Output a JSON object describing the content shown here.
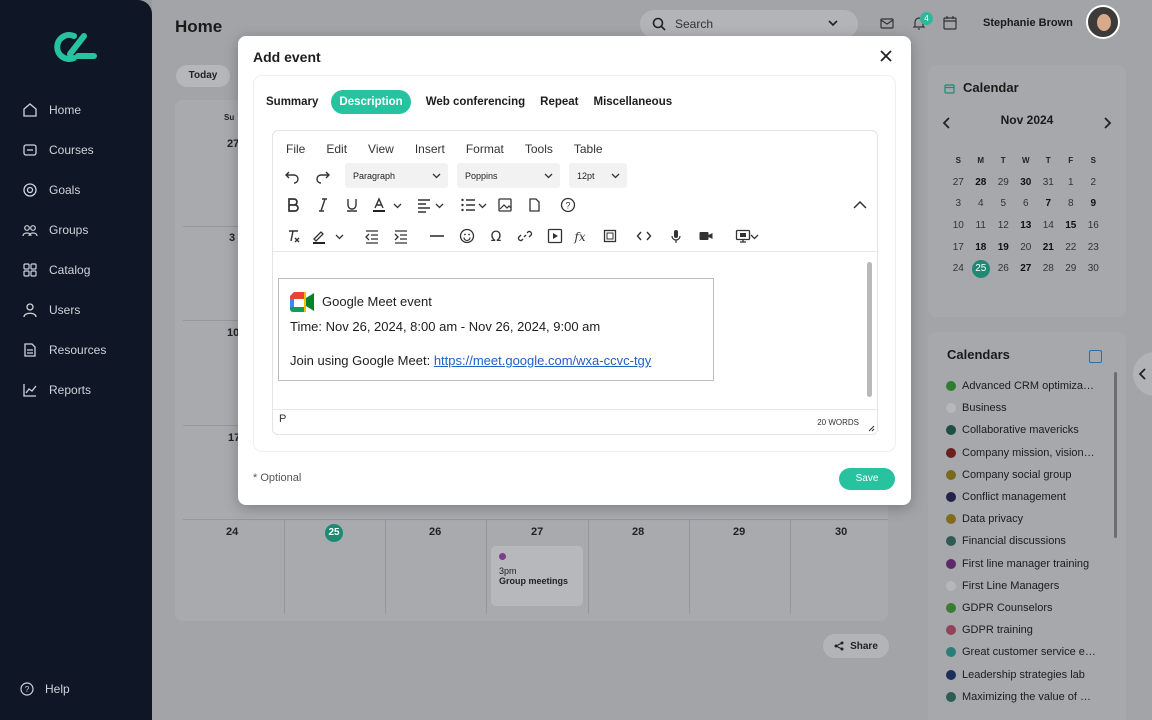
{
  "app": {
    "page_title": "Home",
    "search": {
      "placeholder": "Search"
    },
    "notification_count": "4",
    "user_name": "Stephanie Brown"
  },
  "sidebar": {
    "items": [
      {
        "label": "Home",
        "icon": "home-icon"
      },
      {
        "label": "Courses",
        "icon": "courses-icon"
      },
      {
        "label": "Goals",
        "icon": "goals-icon"
      },
      {
        "label": "Groups",
        "icon": "groups-icon"
      },
      {
        "label": "Catalog",
        "icon": "catalog-icon"
      },
      {
        "label": "Users",
        "icon": "users-icon"
      },
      {
        "label": "Resources",
        "icon": "resources-icon"
      },
      {
        "label": "Reports",
        "icon": "reports-icon"
      }
    ],
    "help_label": "Help"
  },
  "calendar_main": {
    "today_label": "Today",
    "partial_day_header": "Su",
    "week_start_days": [
      "27",
      "3",
      "10",
      "17"
    ],
    "last_week_days": [
      "24",
      "25",
      "26",
      "27",
      "28",
      "29",
      "30"
    ],
    "event": {
      "time": "3pm",
      "title": "Group meetings"
    },
    "share_label": "Share"
  },
  "mini_calendar": {
    "title": "Calendar",
    "month": "Nov 2024",
    "weekdays": [
      "S",
      "M",
      "T",
      "W",
      "T",
      "F",
      "S"
    ],
    "weeks": [
      [
        "27",
        "28",
        "29",
        "30",
        "31",
        "1",
        "2"
      ],
      [
        "3",
        "4",
        "5",
        "6",
        "7",
        "8",
        "9"
      ],
      [
        "10",
        "11",
        "12",
        "13",
        "14",
        "15",
        "16"
      ],
      [
        "17",
        "18",
        "19",
        "20",
        "21",
        "22",
        "23"
      ],
      [
        "24",
        "25",
        "26",
        "27",
        "28",
        "29",
        "30"
      ]
    ],
    "today": "25"
  },
  "calendars": {
    "title": "Calendars",
    "items": [
      {
        "label": "Advanced CRM optimiza…",
        "color": "#2e7d32"
      },
      {
        "label": "Business",
        "color": "#b6b7bb"
      },
      {
        "label": "Collaborative mavericks",
        "color": "#1f4e45"
      },
      {
        "label": "Company mission, vision…",
        "color": "#6b1f1f"
      },
      {
        "label": "Company social group",
        "color": "#7a6a1c"
      },
      {
        "label": "Conflict management",
        "color": "#22224a"
      },
      {
        "label": "Data privacy",
        "color": "#806c1a"
      },
      {
        "label": "Financial discussions",
        "color": "#2f5a55"
      },
      {
        "label": "First line manager training",
        "color": "#5c2a6a"
      },
      {
        "label": "First Line Managers",
        "color": "#b6b7bb"
      },
      {
        "label": "GDPR Counselors",
        "color": "#3b7a32"
      },
      {
        "label": "GDPR training",
        "color": "#93425a"
      },
      {
        "label": "Great customer service e…",
        "color": "#2b7d7a"
      },
      {
        "label": "Leadership strategies lab",
        "color": "#1c2e5a"
      },
      {
        "label": "Maximizing the value of …",
        "color": "#2d5d55"
      }
    ]
  },
  "modal": {
    "title": "Add event",
    "tabs": [
      "Summary",
      "Description",
      "Web conferencing",
      "Repeat",
      "Miscellaneous"
    ],
    "active_tab": "Description",
    "menubar": [
      "File",
      "Edit",
      "View",
      "Insert",
      "Format",
      "Tools",
      "Table"
    ],
    "block_format": "Paragraph",
    "font_family": "Poppins",
    "font_size": "12pt",
    "content": {
      "heading": "Google Meet event",
      "time_line": "Time: Nov 26, 2024, 8:00 am - Nov 26, 2024, 9:00 am",
      "join_prefix": "Join using Google Meet: ",
      "join_link": "https://meet.google.com/wxa-ccvc-tgy"
    },
    "status_path": "P",
    "word_count": "20 WORDS",
    "optional_note": "* Optional",
    "save_label": "Save"
  },
  "colors": {
    "accent": "#27c3a0",
    "sidebar_bg": "#0f1626",
    "link": "#1f62c4"
  }
}
